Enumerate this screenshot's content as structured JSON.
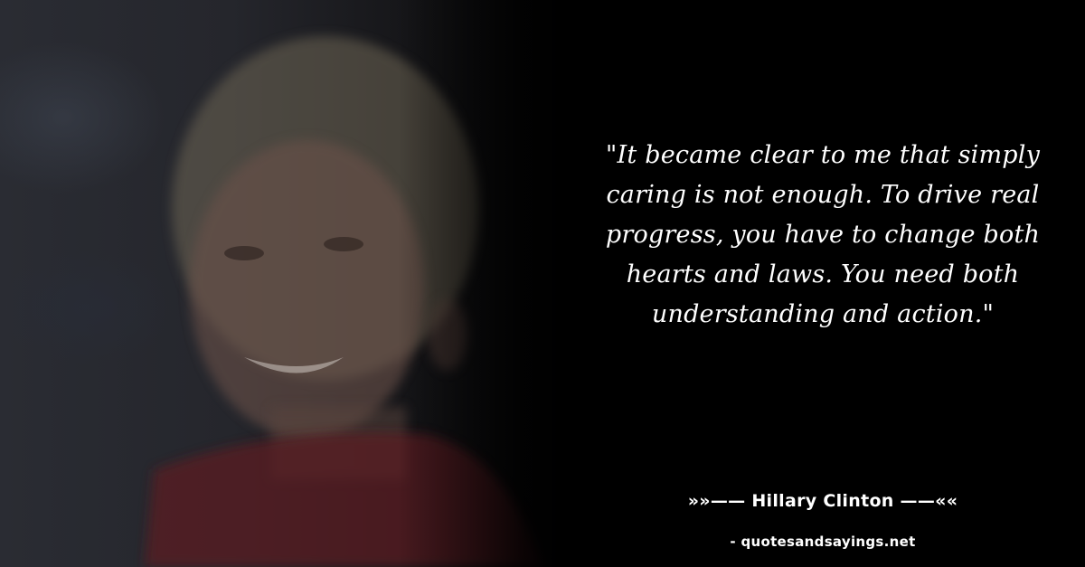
{
  "quote": {
    "text": "\"It became clear to me that simply caring is not enough. To drive real progress, you have to change both hearts and laws. You need both understanding and action.\""
  },
  "author": {
    "text": "»»—— Hillary Clinton ——««"
  },
  "source": {
    "text": "- quotesandsayings.net"
  },
  "colors": {
    "background": "#000000",
    "text": "#ffffff"
  }
}
